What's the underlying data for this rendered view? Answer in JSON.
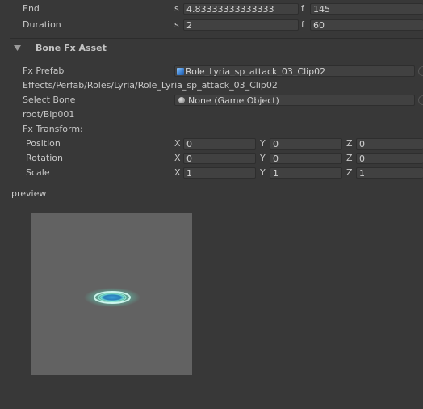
{
  "timing": {
    "end": {
      "label": "End",
      "s_prefix": "s",
      "s_value": "4.83333333333333",
      "f_prefix": "f",
      "f_value": "145"
    },
    "duration": {
      "label": "Duration",
      "s_prefix": "s",
      "s_value": "2",
      "f_prefix": "f",
      "f_value": "60"
    }
  },
  "bone_fx": {
    "header": "Bone Fx Asset",
    "fx_prefab_label": "Fx Prefab",
    "fx_prefab_value": "Role_Lyria_sp_attack_03_Clip02",
    "fx_prefab_path": "Effects/Perfab/Roles/Lyria/Role_Lyria_sp_attack_03_Clip02",
    "select_bone_label": "Select Bone",
    "select_bone_value": "None (Game Object)",
    "bone_path": "root/Bip001",
    "fx_transform_label": "Fx Transform:",
    "transform": {
      "position": {
        "label": "Position",
        "x": "0",
        "y": "0",
        "z": "0"
      },
      "rotation": {
        "label": "Rotation",
        "x": "0",
        "y": "0",
        "z": "0"
      },
      "scale": {
        "label": "Scale",
        "x": "1",
        "y": "1",
        "z": "1"
      }
    },
    "axis_x": "X",
    "axis_y": "Y",
    "axis_z": "Z"
  },
  "preview_label": "preview",
  "icons": {
    "fx_prefab": "prefab-cube-icon",
    "select_bone": "gameobject-ball-icon",
    "foldout": "triangle-down-icon"
  },
  "colors": {
    "background": "#383838",
    "field": "#414141",
    "preview_bg": "#626262",
    "glow": "#5fe8c8"
  }
}
